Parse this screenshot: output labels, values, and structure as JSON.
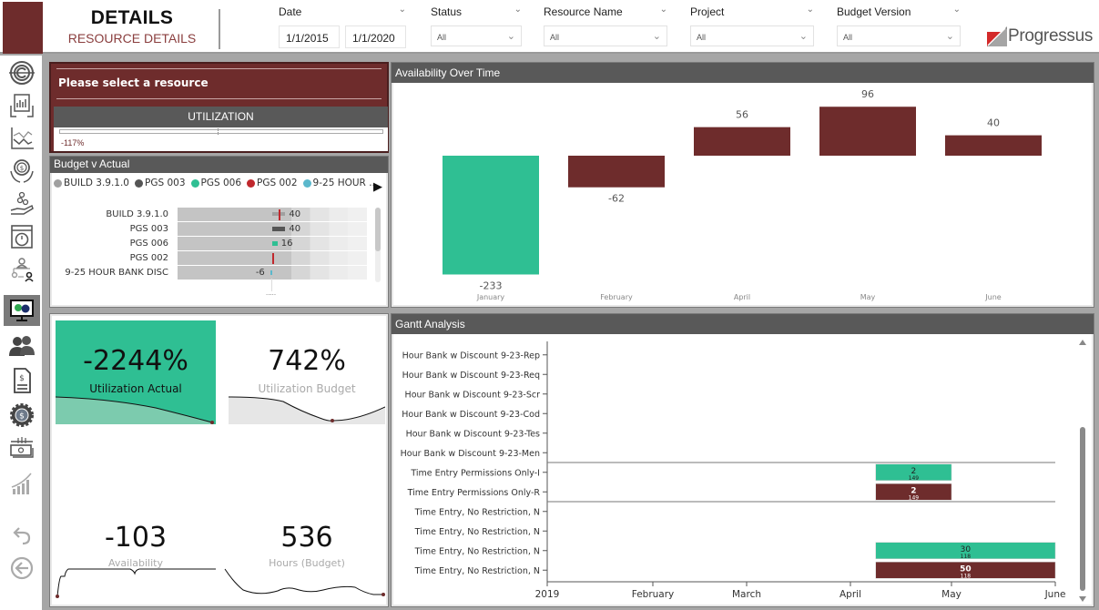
{
  "header": {
    "title": "DETAILS",
    "subtitle": "RESOURCE DETAILS",
    "filters": {
      "date": {
        "label": "Date",
        "from": "1/1/2015",
        "to": "1/1/2020"
      },
      "status": {
        "label": "Status",
        "value": "All"
      },
      "resource_name": {
        "label": "Resource Name",
        "value": "All"
      },
      "project": {
        "label": "Project",
        "value": "All"
      },
      "budget_version": {
        "label": "Budget Version",
        "value": "All"
      }
    },
    "logo_text": "Progressus"
  },
  "sidebar": {
    "items": [
      {
        "name": "overview",
        "icon": "gear-c-icon"
      },
      {
        "name": "reports",
        "icon": "report-hands-icon"
      },
      {
        "name": "trends",
        "icon": "line-chart-icon"
      },
      {
        "name": "finance",
        "icon": "money-hands-icon"
      },
      {
        "name": "budget",
        "icon": "coins-hand-icon"
      },
      {
        "name": "timesheet",
        "icon": "stopwatch-window-icon"
      },
      {
        "name": "org",
        "icon": "org-chart-icon"
      },
      {
        "name": "details",
        "icon": "monitor-gears-icon",
        "active": true
      },
      {
        "name": "resources",
        "icon": "users-icon"
      },
      {
        "name": "invoices",
        "icon": "invoice-icon"
      },
      {
        "name": "billing-settings",
        "icon": "dollar-gear-icon"
      },
      {
        "name": "cash",
        "icon": "cash-icon"
      },
      {
        "name": "growth",
        "icon": "growth-chart-icon"
      }
    ],
    "back_icon": "undo-icon",
    "return_icon": "circle-arrow-left-icon"
  },
  "selection": {
    "title": "Please select a resource",
    "utilization_header": "UTILIZATION",
    "utilization_value": "-117%"
  },
  "budget_v_actual": {
    "title": "Budget v Actual",
    "legend": [
      {
        "label": "BUILD 3.9.1.0",
        "color": "#a0a0a0"
      },
      {
        "label": "PGS 003",
        "color": "#555555"
      },
      {
        "label": "PGS 006",
        "color": "#2fbf93"
      },
      {
        "label": "PGS 002",
        "color": "#c0282d"
      },
      {
        "label": "9-25 HOUR ...",
        "color": "#5bb8cc"
      }
    ],
    "rows": [
      {
        "label": "BUILD 3.9.1.0",
        "value": "40",
        "actual": 40,
        "target": 40,
        "color": "#a0a0a0"
      },
      {
        "label": "PGS 003",
        "value": "40",
        "actual": 40,
        "target": null,
        "color": "#555555"
      },
      {
        "label": "PGS 006",
        "value": "16",
        "actual": 16,
        "target": null,
        "color": "#2fbf93"
      },
      {
        "label": "PGS 002",
        "value": "",
        "actual": 0,
        "target": 0,
        "color": "#c0282d"
      },
      {
        "label": "9-25 HOUR BANK DISC",
        "value": "-6",
        "actual": -6,
        "target": null,
        "color": "#5bb8cc"
      }
    ],
    "more": "....."
  },
  "kpis": [
    {
      "value": "-2244%",
      "label": "Utilization Actual"
    },
    {
      "value": "742%",
      "label": "Utilization Budget"
    },
    {
      "value": "-103",
      "label": "Availability"
    },
    {
      "value": "536",
      "label": "Hours (Budget)"
    }
  ],
  "availability": {
    "title": "Availability Over Time"
  },
  "gantt": {
    "title": "Gantt Analysis",
    "rows": [
      "Hour Bank w Discount 9-23-Rep",
      "Hour Bank w Discount 9-23-Req",
      "Hour Bank w Discount 9-23-Scr",
      "Hour Bank w Discount 9-23-Cod",
      "Hour Bank w Discount 9-23-Tes",
      "Hour Bank w Discount 9-23-Men",
      "Time Entry Permissions Only-I",
      "Time Entry Permissions Only-R",
      "Time Entry, No Restriction, N",
      "Time Entry, No Restriction, N",
      "Time Entry, No Restriction, N",
      "Time Entry, No Restriction, N"
    ],
    "x_ticks": [
      "2019",
      "February",
      "March",
      "April",
      "May",
      "June"
    ],
    "bars": [
      {
        "row": 6,
        "start_month": 3.25,
        "end_month": 4.0,
        "label": "2",
        "sublabel": "149",
        "color": "#2fbf93"
      },
      {
        "row": 7,
        "start_month": 3.25,
        "end_month": 4.0,
        "label": "2",
        "sublabel": "149",
        "color": "#6e2c2c"
      },
      {
        "row": 10,
        "start_month": 3.25,
        "end_month": 5.0,
        "label": "30",
        "sublabel": "118",
        "color": "#2fbf93"
      },
      {
        "row": 11,
        "start_month": 3.25,
        "end_month": 5.0,
        "label": "50",
        "sublabel": "118",
        "color": "#6e2c2c"
      }
    ],
    "group_dividers_after_rows": [
      5,
      7
    ]
  },
  "colors": {
    "brand": "#6e2c2c",
    "accent": "#2fbf93",
    "header_bar": "#595959"
  },
  "chart_data": {
    "type": "bar",
    "title": "Availability Over Time",
    "subtype": "waterfall",
    "categories": [
      "January",
      "February",
      "April",
      "May",
      "June"
    ],
    "values": [
      -233,
      -62,
      56,
      96,
      40
    ],
    "colors": [
      "#2fbf93",
      "#6e2c2c",
      "#6e2c2c",
      "#6e2c2c",
      "#6e2c2c"
    ],
    "xlabel": "",
    "ylabel": "",
    "grid": false,
    "legend": "none"
  }
}
